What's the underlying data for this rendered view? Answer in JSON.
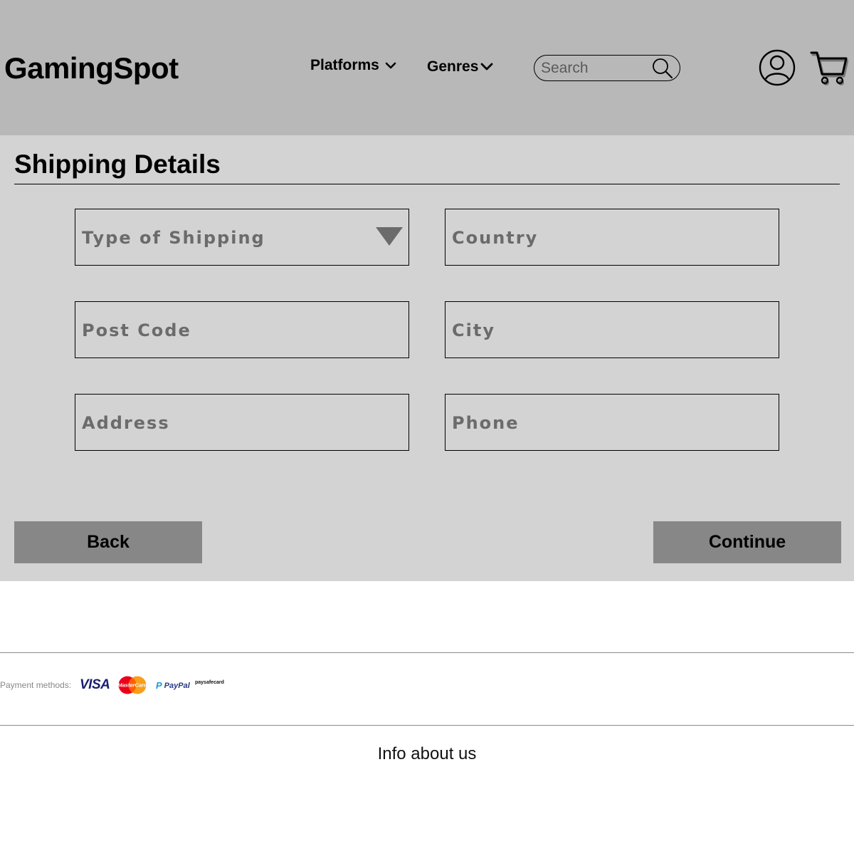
{
  "header": {
    "logo": "GamingSpot",
    "nav": [
      {
        "label": "Platforms",
        "icon": "chevron-down-icon"
      },
      {
        "label": "Genres",
        "icon": "chevron-down-icon"
      }
    ],
    "search": {
      "placeholder": "Search",
      "value": "",
      "icon": "search-icon"
    },
    "icons": [
      "user-icon",
      "cart-icon"
    ],
    "background": "#b8b8b8"
  },
  "main": {
    "title": "Shipping Details",
    "background": "#d3d3d3",
    "fields": {
      "shipping_type": {
        "placeholder": "Type of Shipping",
        "value": "",
        "icon": "dropdown-arrow-icon"
      },
      "country": {
        "placeholder": "Country",
        "value": ""
      },
      "post_code": {
        "placeholder": "Post Code",
        "value": ""
      },
      "city": {
        "placeholder": "City",
        "value": ""
      },
      "address": {
        "placeholder": "Address",
        "value": ""
      },
      "phone": {
        "placeholder": "Phone",
        "value": ""
      }
    },
    "buttons": {
      "back": "Back",
      "continue": "Continue",
      "color": "#878787"
    }
  },
  "footer": {
    "payment_label": "Payment methods:",
    "payment_methods": {
      "visa": "VISA",
      "mastercard": "MasterCard",
      "paypal": "PayPal",
      "paysafecard": "paysafecard"
    },
    "info": "Info about us"
  }
}
